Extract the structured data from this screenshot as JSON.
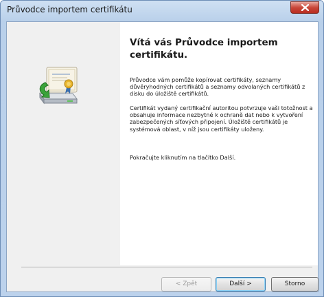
{
  "window": {
    "title": "Průvodce importem certifikátu"
  },
  "wizard": {
    "heading": "Vítá vás Průvodce importem certifikátu.",
    "paragraph1": "Průvodce vám pomůže kopírovat certifikáty, seznamy důvěryhodných certifikátů a seznamy odvolaných certifikátů z disku do úložiště certifikátů.",
    "paragraph2": "Certifikát vydaný certifikační autoritou potvrzuje vaši totožnost a obsahuje informace nezbytné k ochraně dat nebo k vytvoření zabezpečených síťových připojení. Úložiště certifikátů je systémová oblast, v níž jsou certifikáty uloženy.",
    "paragraph3": "Pokračujte kliknutím na tlačítko Další."
  },
  "buttons": {
    "back": "< Zpět",
    "next": "Další >",
    "cancel": "Storno"
  },
  "icons": {
    "wizard_icon": "certificate-import-icon",
    "close": "close-icon"
  },
  "colors": {
    "title_bar": "#bcd2ec",
    "close_button": "#c9473a",
    "panel_gray": "#f0f0f0"
  }
}
